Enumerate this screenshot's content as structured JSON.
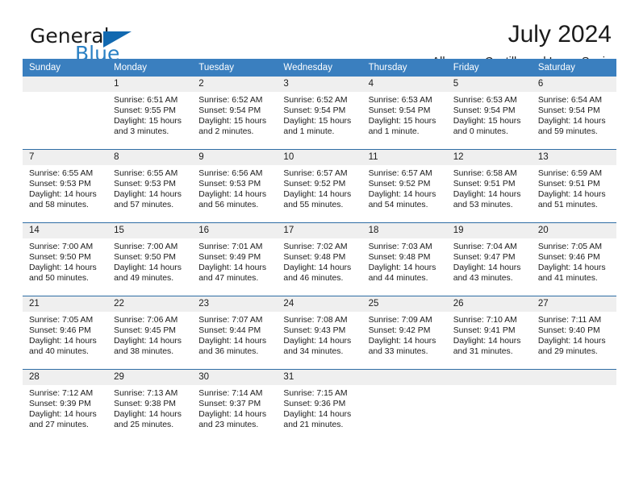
{
  "brand": {
    "name_part1": "General",
    "name_part2": "Blue",
    "logo_icon": "triangle-logo-icon"
  },
  "header": {
    "month_title": "July 2024",
    "location": "Albornos, Castille and Leon, Spain"
  },
  "colors": {
    "header_blue": "#3a7fbf",
    "separator_blue": "#2e6da4",
    "daynum_band": "#efefef",
    "brand_blue": "#2980c4",
    "logo_blue": "#1269b0",
    "text": "#1b1b1b"
  },
  "calendar": {
    "day_headers": [
      "Sunday",
      "Monday",
      "Tuesday",
      "Wednesday",
      "Thursday",
      "Friday",
      "Saturday"
    ],
    "weeks": [
      {
        "days": [
          {
            "num": "",
            "sunrise": "",
            "sunset": "",
            "daylight_line1": "",
            "daylight_line2": ""
          },
          {
            "num": "1",
            "sunrise": "Sunrise: 6:51 AM",
            "sunset": "Sunset: 9:55 PM",
            "daylight_line1": "Daylight: 15 hours",
            "daylight_line2": "and 3 minutes."
          },
          {
            "num": "2",
            "sunrise": "Sunrise: 6:52 AM",
            "sunset": "Sunset: 9:54 PM",
            "daylight_line1": "Daylight: 15 hours",
            "daylight_line2": "and 2 minutes."
          },
          {
            "num": "3",
            "sunrise": "Sunrise: 6:52 AM",
            "sunset": "Sunset: 9:54 PM",
            "daylight_line1": "Daylight: 15 hours",
            "daylight_line2": "and 1 minute."
          },
          {
            "num": "4",
            "sunrise": "Sunrise: 6:53 AM",
            "sunset": "Sunset: 9:54 PM",
            "daylight_line1": "Daylight: 15 hours",
            "daylight_line2": "and 1 minute."
          },
          {
            "num": "5",
            "sunrise": "Sunrise: 6:53 AM",
            "sunset": "Sunset: 9:54 PM",
            "daylight_line1": "Daylight: 15 hours",
            "daylight_line2": "and 0 minutes."
          },
          {
            "num": "6",
            "sunrise": "Sunrise: 6:54 AM",
            "sunset": "Sunset: 9:54 PM",
            "daylight_line1": "Daylight: 14 hours",
            "daylight_line2": "and 59 minutes."
          }
        ]
      },
      {
        "days": [
          {
            "num": "7",
            "sunrise": "Sunrise: 6:55 AM",
            "sunset": "Sunset: 9:53 PM",
            "daylight_line1": "Daylight: 14 hours",
            "daylight_line2": "and 58 minutes."
          },
          {
            "num": "8",
            "sunrise": "Sunrise: 6:55 AM",
            "sunset": "Sunset: 9:53 PM",
            "daylight_line1": "Daylight: 14 hours",
            "daylight_line2": "and 57 minutes."
          },
          {
            "num": "9",
            "sunrise": "Sunrise: 6:56 AM",
            "sunset": "Sunset: 9:53 PM",
            "daylight_line1": "Daylight: 14 hours",
            "daylight_line2": "and 56 minutes."
          },
          {
            "num": "10",
            "sunrise": "Sunrise: 6:57 AM",
            "sunset": "Sunset: 9:52 PM",
            "daylight_line1": "Daylight: 14 hours",
            "daylight_line2": "and 55 minutes."
          },
          {
            "num": "11",
            "sunrise": "Sunrise: 6:57 AM",
            "sunset": "Sunset: 9:52 PM",
            "daylight_line1": "Daylight: 14 hours",
            "daylight_line2": "and 54 minutes."
          },
          {
            "num": "12",
            "sunrise": "Sunrise: 6:58 AM",
            "sunset": "Sunset: 9:51 PM",
            "daylight_line1": "Daylight: 14 hours",
            "daylight_line2": "and 53 minutes."
          },
          {
            "num": "13",
            "sunrise": "Sunrise: 6:59 AM",
            "sunset": "Sunset: 9:51 PM",
            "daylight_line1": "Daylight: 14 hours",
            "daylight_line2": "and 51 minutes."
          }
        ]
      },
      {
        "days": [
          {
            "num": "14",
            "sunrise": "Sunrise: 7:00 AM",
            "sunset": "Sunset: 9:50 PM",
            "daylight_line1": "Daylight: 14 hours",
            "daylight_line2": "and 50 minutes."
          },
          {
            "num": "15",
            "sunrise": "Sunrise: 7:00 AM",
            "sunset": "Sunset: 9:50 PM",
            "daylight_line1": "Daylight: 14 hours",
            "daylight_line2": "and 49 minutes."
          },
          {
            "num": "16",
            "sunrise": "Sunrise: 7:01 AM",
            "sunset": "Sunset: 9:49 PM",
            "daylight_line1": "Daylight: 14 hours",
            "daylight_line2": "and 47 minutes."
          },
          {
            "num": "17",
            "sunrise": "Sunrise: 7:02 AM",
            "sunset": "Sunset: 9:48 PM",
            "daylight_line1": "Daylight: 14 hours",
            "daylight_line2": "and 46 minutes."
          },
          {
            "num": "18",
            "sunrise": "Sunrise: 7:03 AM",
            "sunset": "Sunset: 9:48 PM",
            "daylight_line1": "Daylight: 14 hours",
            "daylight_line2": "and 44 minutes."
          },
          {
            "num": "19",
            "sunrise": "Sunrise: 7:04 AM",
            "sunset": "Sunset: 9:47 PM",
            "daylight_line1": "Daylight: 14 hours",
            "daylight_line2": "and 43 minutes."
          },
          {
            "num": "20",
            "sunrise": "Sunrise: 7:05 AM",
            "sunset": "Sunset: 9:46 PM",
            "daylight_line1": "Daylight: 14 hours",
            "daylight_line2": "and 41 minutes."
          }
        ]
      },
      {
        "days": [
          {
            "num": "21",
            "sunrise": "Sunrise: 7:05 AM",
            "sunset": "Sunset: 9:46 PM",
            "daylight_line1": "Daylight: 14 hours",
            "daylight_line2": "and 40 minutes."
          },
          {
            "num": "22",
            "sunrise": "Sunrise: 7:06 AM",
            "sunset": "Sunset: 9:45 PM",
            "daylight_line1": "Daylight: 14 hours",
            "daylight_line2": "and 38 minutes."
          },
          {
            "num": "23",
            "sunrise": "Sunrise: 7:07 AM",
            "sunset": "Sunset: 9:44 PM",
            "daylight_line1": "Daylight: 14 hours",
            "daylight_line2": "and 36 minutes."
          },
          {
            "num": "24",
            "sunrise": "Sunrise: 7:08 AM",
            "sunset": "Sunset: 9:43 PM",
            "daylight_line1": "Daylight: 14 hours",
            "daylight_line2": "and 34 minutes."
          },
          {
            "num": "25",
            "sunrise": "Sunrise: 7:09 AM",
            "sunset": "Sunset: 9:42 PM",
            "daylight_line1": "Daylight: 14 hours",
            "daylight_line2": "and 33 minutes."
          },
          {
            "num": "26",
            "sunrise": "Sunrise: 7:10 AM",
            "sunset": "Sunset: 9:41 PM",
            "daylight_line1": "Daylight: 14 hours",
            "daylight_line2": "and 31 minutes."
          },
          {
            "num": "27",
            "sunrise": "Sunrise: 7:11 AM",
            "sunset": "Sunset: 9:40 PM",
            "daylight_line1": "Daylight: 14 hours",
            "daylight_line2": "and 29 minutes."
          }
        ]
      },
      {
        "days": [
          {
            "num": "28",
            "sunrise": "Sunrise: 7:12 AM",
            "sunset": "Sunset: 9:39 PM",
            "daylight_line1": "Daylight: 14 hours",
            "daylight_line2": "and 27 minutes."
          },
          {
            "num": "29",
            "sunrise": "Sunrise: 7:13 AM",
            "sunset": "Sunset: 9:38 PM",
            "daylight_line1": "Daylight: 14 hours",
            "daylight_line2": "and 25 minutes."
          },
          {
            "num": "30",
            "sunrise": "Sunrise: 7:14 AM",
            "sunset": "Sunset: 9:37 PM",
            "daylight_line1": "Daylight: 14 hours",
            "daylight_line2": "and 23 minutes."
          },
          {
            "num": "31",
            "sunrise": "Sunrise: 7:15 AM",
            "sunset": "Sunset: 9:36 PM",
            "daylight_line1": "Daylight: 14 hours",
            "daylight_line2": "and 21 minutes."
          },
          {
            "num": "",
            "sunrise": "",
            "sunset": "",
            "daylight_line1": "",
            "daylight_line2": ""
          },
          {
            "num": "",
            "sunrise": "",
            "sunset": "",
            "daylight_line1": "",
            "daylight_line2": ""
          },
          {
            "num": "",
            "sunrise": "",
            "sunset": "",
            "daylight_line1": "",
            "daylight_line2": ""
          }
        ]
      }
    ]
  }
}
